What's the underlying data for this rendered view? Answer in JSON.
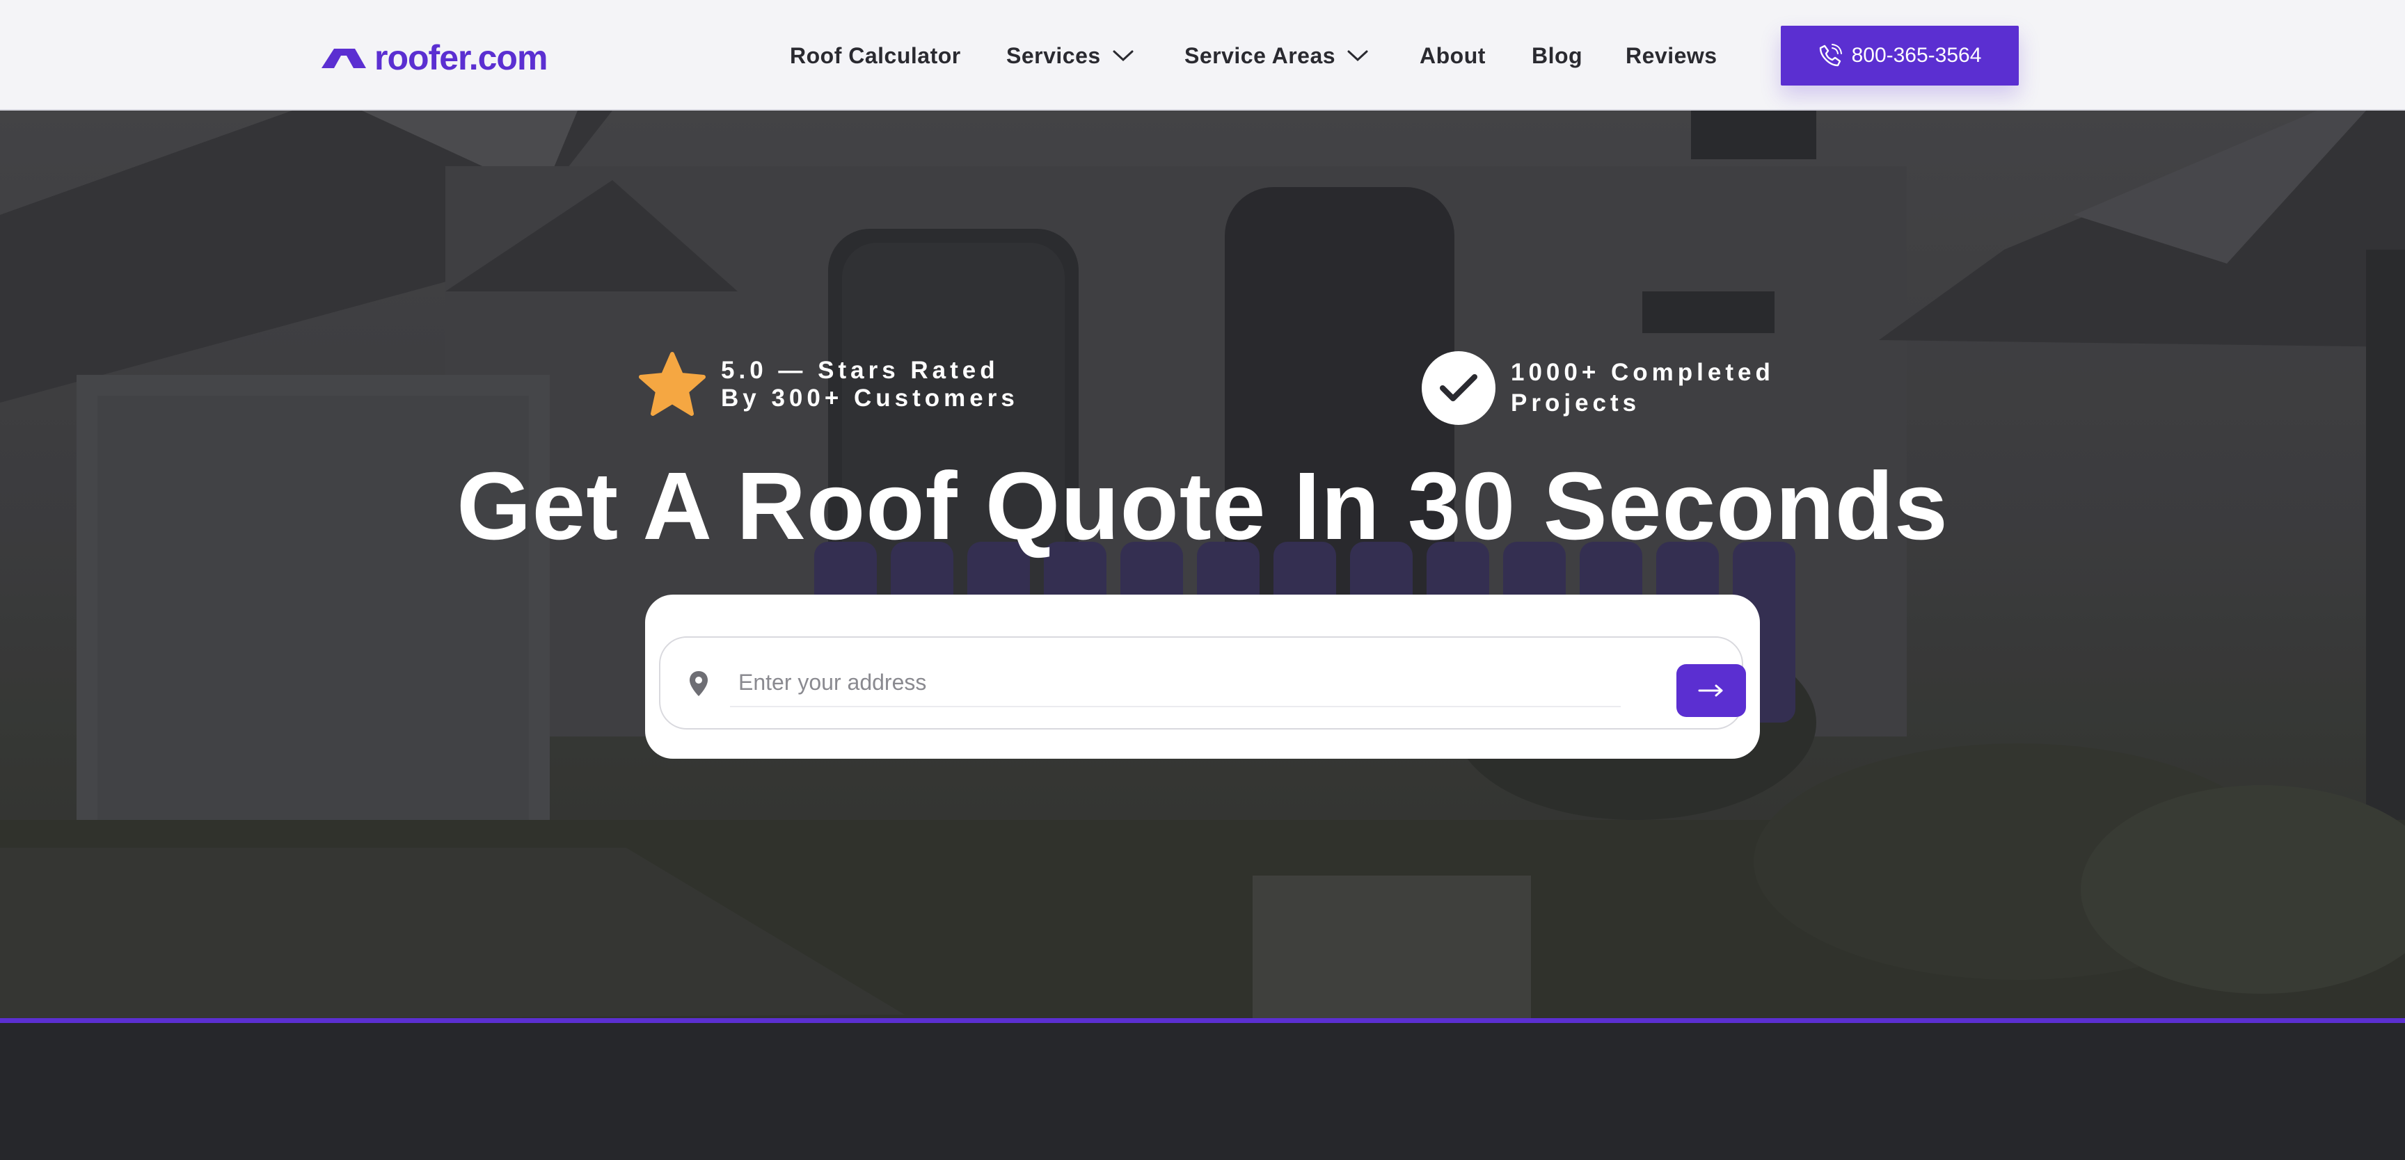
{
  "brand": {
    "name": "roofer.com",
    "accent_color": "#5b2fd1"
  },
  "nav": {
    "items": [
      {
        "label": "Roof Calculator",
        "has_dropdown": false
      },
      {
        "label": "Services",
        "has_dropdown": true
      },
      {
        "label": "Service Areas",
        "has_dropdown": true
      },
      {
        "label": "About",
        "has_dropdown": false
      },
      {
        "label": "Blog",
        "has_dropdown": false
      },
      {
        "label": "Reviews",
        "has_dropdown": false
      }
    ],
    "phone_label": "800-365-3564",
    "phone_icon": "phone-icon",
    "dropdown_icon": "chevron-down-icon"
  },
  "hero": {
    "rating_badge": {
      "line1": "5.0 — Stars Rated",
      "line2": "By 300+ Customers",
      "icon": "star-icon",
      "icon_color": "#f5a742"
    },
    "projects_badge": {
      "line1": "1000+ Completed",
      "line2": "Projects",
      "icon": "check-circle-icon"
    },
    "headline": "Get A Roof Quote In 30 Seconds",
    "search": {
      "placeholder": "Enter your address",
      "value": "",
      "pin_icon": "location-pin-icon",
      "submit_icon": "arrow-right-icon"
    },
    "background": "darkened photo of a house with a roofing crew"
  }
}
